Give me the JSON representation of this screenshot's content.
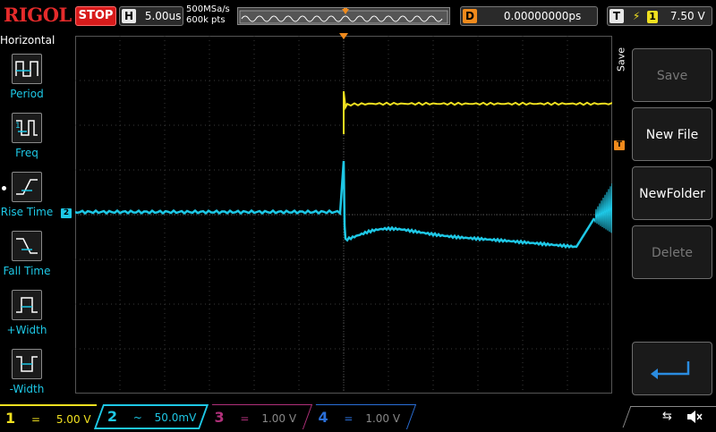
{
  "topbar": {
    "logo": "RIGOL",
    "run_state": "STOP",
    "horizontal": {
      "label": "H",
      "value": "5.00us"
    },
    "sample_rate": "500MSa/s",
    "memory_depth": "600k pts",
    "delay": {
      "label": "D",
      "value": "0.00000000ps"
    },
    "trigger": {
      "label": "T",
      "source": "1",
      "level": "7.50 V"
    }
  },
  "left_menu": {
    "title": "Horizontal",
    "items": [
      {
        "label": "Period"
      },
      {
        "label": "Freq"
      },
      {
        "label": "Rise Time"
      },
      {
        "label": "Fall Time"
      },
      {
        "label": "+Width"
      },
      {
        "label": "-Width"
      }
    ]
  },
  "right_menu": {
    "title": "Save",
    "buttons": [
      {
        "label": "Save",
        "enabled": false
      },
      {
        "label": "New File",
        "enabled": true
      },
      {
        "label": "NewFolder",
        "enabled": true
      },
      {
        "label": "Delete",
        "enabled": false
      }
    ]
  },
  "markers": {
    "ch2_level": "2",
    "trigger_level": "T"
  },
  "channels": [
    {
      "num": "1",
      "coupling": "=",
      "scale": "5.00 V",
      "color": "#f0e020",
      "active": true
    },
    {
      "num": "2",
      "coupling": "~",
      "scale": "50.0mV",
      "color": "#1ec8e6",
      "active": true
    },
    {
      "num": "3",
      "coupling": "=",
      "scale": "1.00 V",
      "color": "#b0307a",
      "active": false
    },
    {
      "num": "4",
      "coupling": "=",
      "scale": "1.00 V",
      "color": "#2a6fd8",
      "active": false
    }
  ],
  "colors": {
    "ch1": "#f0e020",
    "ch2": "#1ec8e6",
    "trigger": "#f08a1c",
    "logo": "#e52b2b"
  }
}
